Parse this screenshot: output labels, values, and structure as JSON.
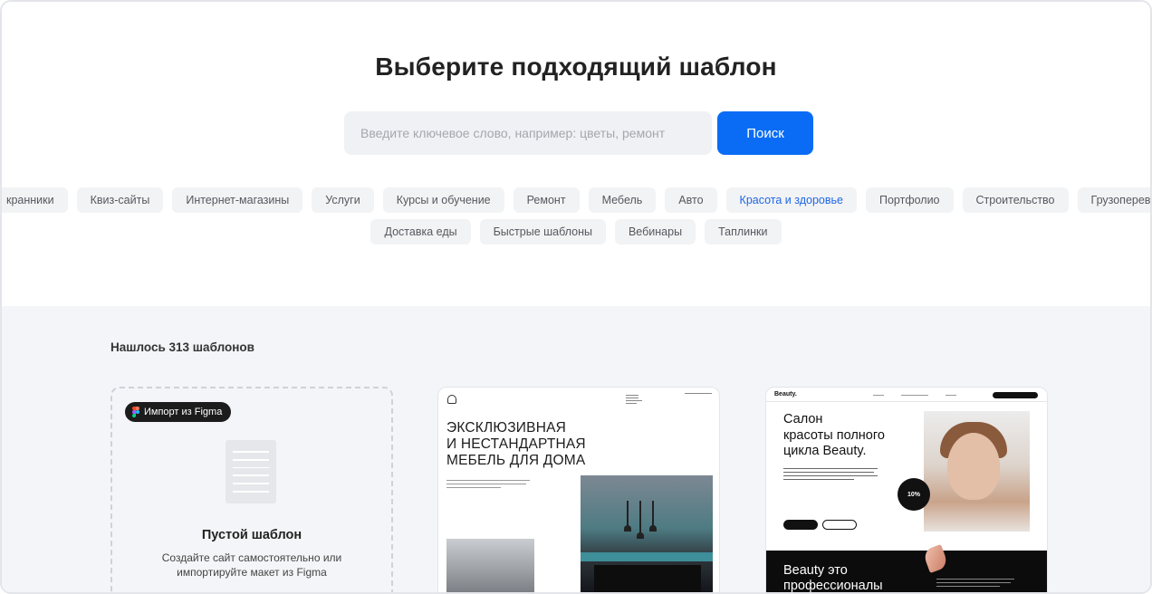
{
  "page": {
    "title": "Выберите подходящий шаблон"
  },
  "search": {
    "placeholder": "Введите ключевое слово, например: цветы, ремонт",
    "value": "",
    "button_label": "Поиск"
  },
  "categories": {
    "row1": [
      {
        "label": "кранники",
        "active": false
      },
      {
        "label": "Квиз-сайты",
        "active": false
      },
      {
        "label": "Интернет-магазины",
        "active": false
      },
      {
        "label": "Услуги",
        "active": false
      },
      {
        "label": "Курсы и обучение",
        "active": false
      },
      {
        "label": "Ремонт",
        "active": false
      },
      {
        "label": "Мебель",
        "active": false
      },
      {
        "label": "Авто",
        "active": false
      },
      {
        "label": "Красота и здоровье",
        "active": true
      },
      {
        "label": "Портфолио",
        "active": false
      },
      {
        "label": "Строительство",
        "active": false
      },
      {
        "label": "Грузоперевозки",
        "active": false
      }
    ],
    "row2": [
      {
        "label": "Доставка еды",
        "active": false
      },
      {
        "label": "Быстрые шаблоны",
        "active": false
      },
      {
        "label": "Вебинары",
        "active": false
      },
      {
        "label": "Таплинки",
        "active": false
      }
    ],
    "active_color": "#1f67e6"
  },
  "results": {
    "count_text": "Нашлось 313 шаблонов"
  },
  "empty_card": {
    "badge": "Импорт из Figma",
    "title": "Пустой шаблон",
    "description": "Создайте сайт самостоятельно или импортируйте макет из Figma"
  },
  "furniture_card": {
    "heading_lines": [
      "ЭКСКЛЮЗИВНАЯ",
      "И НЕСТАНДАРТНАЯ",
      "МЕБЕЛЬ ДЛЯ ДОМА"
    ]
  },
  "beauty_card": {
    "logo": "Beauty.",
    "heading_lines": [
      "Салон",
      "красоты полного",
      "цикла Beauty."
    ],
    "badge": "10%",
    "dark_heading_lines": [
      "Beauty это",
      "профессионалы"
    ]
  },
  "colors": {
    "accent": "#0a6cf5",
    "results_bg": "#f4f5f8",
    "chip_bg": "#f2f3f5"
  }
}
